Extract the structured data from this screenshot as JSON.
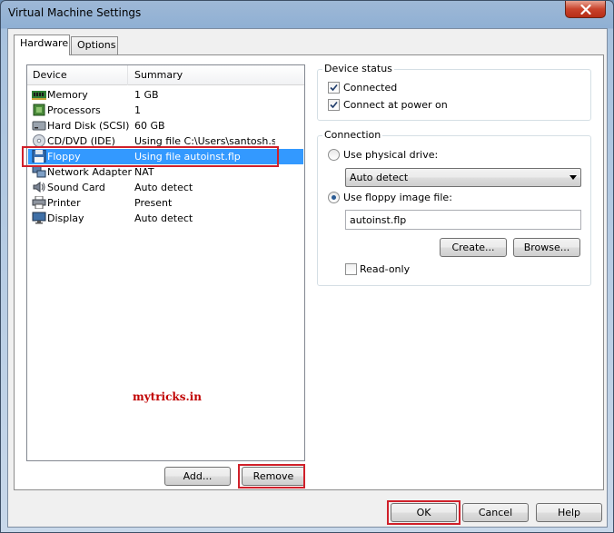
{
  "window": {
    "title": "Virtual Machine Settings"
  },
  "tabs": [
    {
      "label": "Hardware"
    },
    {
      "label": "Options"
    }
  ],
  "device_list": {
    "headers": {
      "device": "Device",
      "summary": "Summary"
    },
    "rows": [
      {
        "name": "Memory",
        "summary": "1 GB",
        "icon": "memory-icon"
      },
      {
        "name": "Processors",
        "summary": "1",
        "icon": "processor-icon"
      },
      {
        "name": "Hard Disk (SCSI)",
        "summary": "60 GB",
        "icon": "hard-disk-icon"
      },
      {
        "name": "CD/DVD (IDE)",
        "summary": "Using file C:\\Users\\santosh.s...",
        "icon": "cd-dvd-icon"
      },
      {
        "name": "Floppy",
        "summary": "Using file autoinst.flp",
        "icon": "floppy-icon"
      },
      {
        "name": "Network Adapter",
        "summary": "NAT",
        "icon": "network-adapter-icon"
      },
      {
        "name": "Sound Card",
        "summary": "Auto detect",
        "icon": "sound-card-icon"
      },
      {
        "name": "Printer",
        "summary": "Present",
        "icon": "printer-icon"
      },
      {
        "name": "Display",
        "summary": "Auto detect",
        "icon": "display-icon"
      }
    ],
    "selected": "Floppy"
  },
  "list_buttons": {
    "add": "Add...",
    "remove": "Remove"
  },
  "watermark": "mytricks.in",
  "device_status": {
    "title": "Device status",
    "connected": {
      "label": "Connected",
      "checked": true
    },
    "connect_at_power_on": {
      "label": "Connect at power on",
      "checked": true
    }
  },
  "connection": {
    "title": "Connection",
    "use_physical_drive": {
      "label": "Use physical drive:",
      "selected": false
    },
    "drive_select": {
      "value": "Auto detect"
    },
    "use_floppy_image": {
      "label": "Use floppy image file:",
      "selected": true
    },
    "image_file": {
      "value": "autoinst.flp"
    },
    "create_button": "Create...",
    "browse_button": "Browse...",
    "read_only": {
      "label": "Read-only",
      "checked": false
    }
  },
  "footer": {
    "ok": "OK",
    "cancel": "Cancel",
    "help": "Help"
  },
  "colors": {
    "selection": "#3399ff",
    "highlight_box": "#d0202a",
    "watermark": "#c00000"
  }
}
